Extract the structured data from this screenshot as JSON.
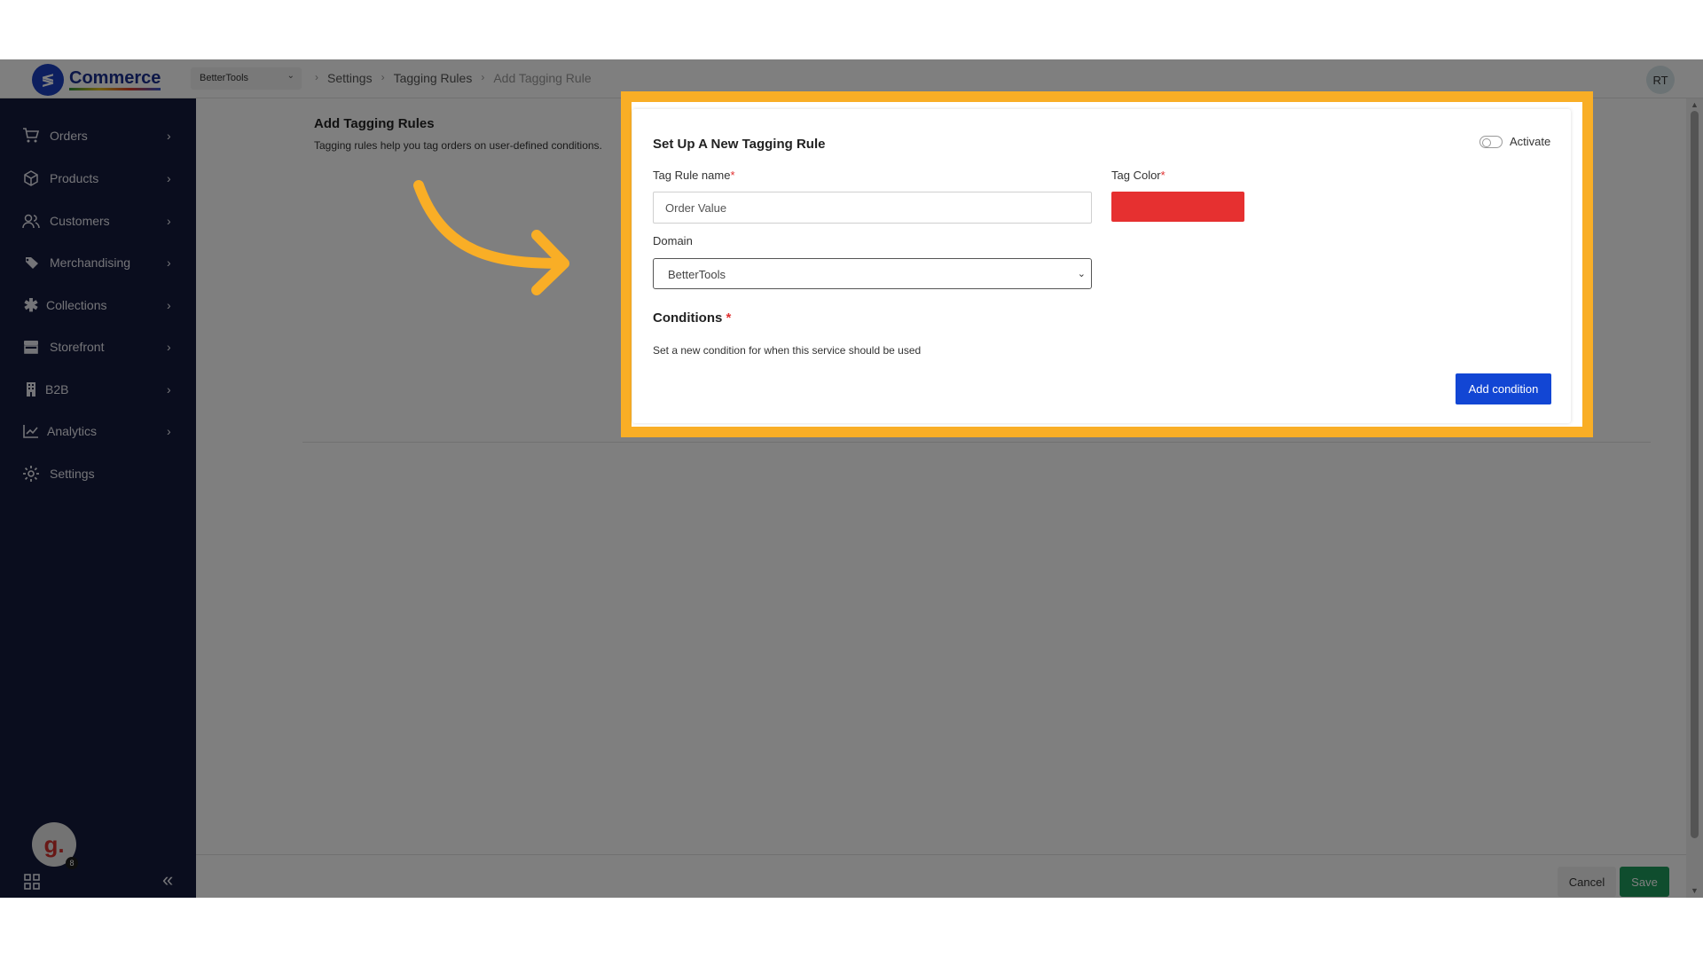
{
  "app": {
    "logo_text": "Commerce",
    "logo_mark": "≶"
  },
  "topbar": {
    "store": "BetterTools",
    "breadcrumb": [
      "Settings",
      "Tagging Rules",
      "Add Tagging Rule"
    ],
    "user_initials": "RT"
  },
  "sidebar": {
    "items": [
      {
        "label": "Orders",
        "icon": "cart-icon"
      },
      {
        "label": "Products",
        "icon": "box-icon"
      },
      {
        "label": "Customers",
        "icon": "users-icon"
      },
      {
        "label": "Merchandising",
        "icon": "tags-icon"
      },
      {
        "label": "Collections",
        "icon": "asterisk-icon"
      },
      {
        "label": "Storefront",
        "icon": "store-icon"
      },
      {
        "label": "B2B",
        "icon": "building-icon"
      },
      {
        "label": "Analytics",
        "icon": "chart-icon"
      },
      {
        "label": "Settings",
        "icon": "gear-icon"
      }
    ],
    "user_avatar_letter": "g.",
    "user_badge": "8"
  },
  "page": {
    "title": "Add Tagging Rules",
    "description": "Tagging rules help you tag orders on user-defined conditions."
  },
  "form": {
    "title": "Set Up A New Tagging Rule",
    "activate_label": "Activate",
    "activate_on": false,
    "tag_rule_name_label": "Tag Rule name",
    "tag_rule_name_value": "Order Value",
    "tag_color_label": "Tag Color",
    "tag_color": "#e63030",
    "required_mark": "*",
    "domain_label": "Domain",
    "domain_value": "BetterTools",
    "conditions_title": "Conditions",
    "conditions_desc": "Set a new condition for when this service should be used",
    "add_condition_label": "Add condition"
  },
  "footer": {
    "cancel_label": "Cancel",
    "save_label": "Save"
  },
  "colors": {
    "highlight": "#f9ae26",
    "sidebar_bg": "#141a3c",
    "primary": "#1246d4",
    "save": "#1f9a5c"
  }
}
